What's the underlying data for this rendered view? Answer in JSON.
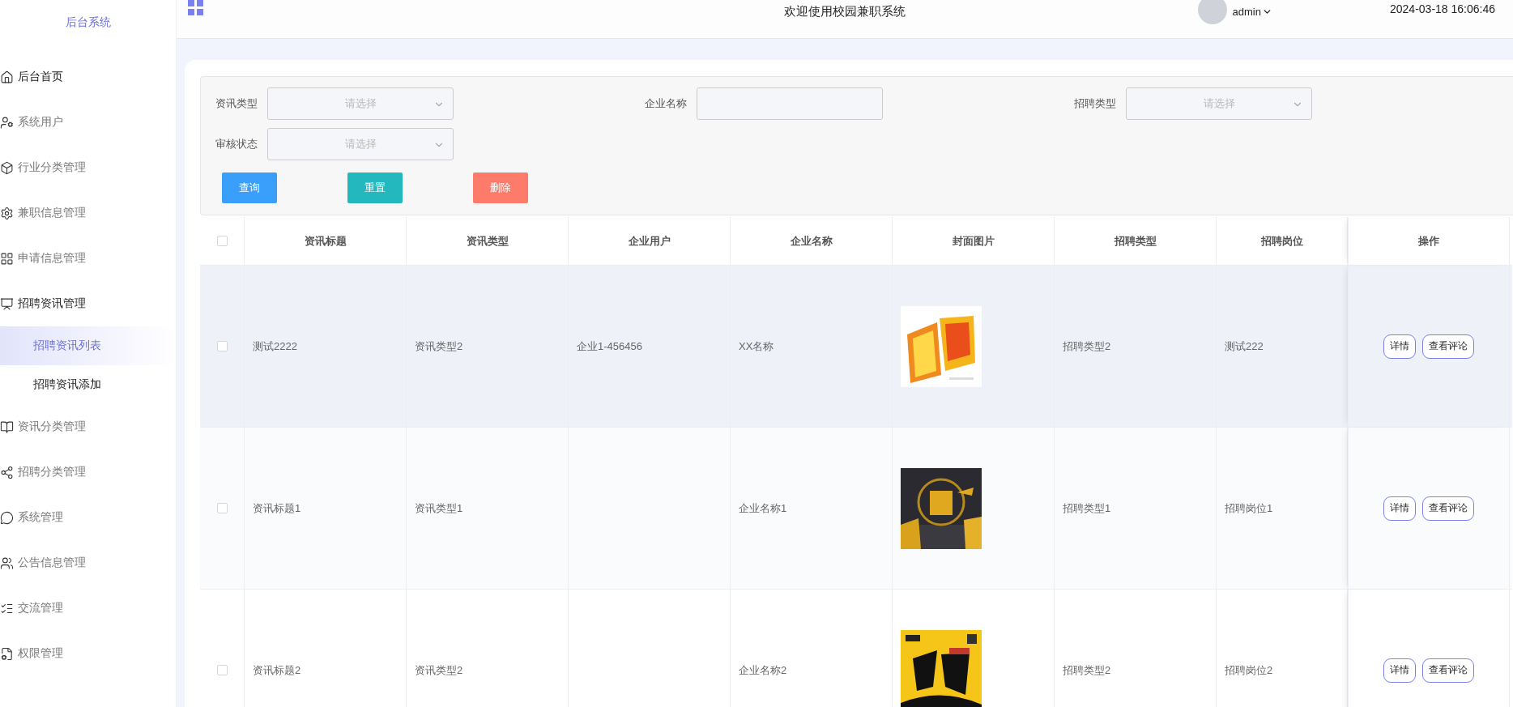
{
  "sidebar": {
    "title": "后台系统",
    "items": [
      {
        "label": "后台首页",
        "active": true
      },
      {
        "label": "系统用户",
        "active": false
      },
      {
        "label": "行业分类管理",
        "active": false
      },
      {
        "label": "兼职信息管理",
        "active": false
      },
      {
        "label": "申请信息管理",
        "active": false
      },
      {
        "label": "招聘资讯管理",
        "active": true,
        "children": [
          {
            "label": "招聘资讯列表",
            "selected": true
          },
          {
            "label": "招聘资讯添加",
            "selected": false
          }
        ]
      },
      {
        "label": "资讯分类管理",
        "active": false
      },
      {
        "label": "招聘分类管理",
        "active": false
      },
      {
        "label": "系统管理",
        "active": false
      },
      {
        "label": "公告信息管理",
        "active": false
      },
      {
        "label": "交流管理",
        "active": false
      },
      {
        "label": "权限管理",
        "active": false
      }
    ]
  },
  "header": {
    "title": "欢迎使用校园兼职系统",
    "user": "admin",
    "datetime": "2024-03-18 16:06:46"
  },
  "filters": [
    {
      "label": "资讯类型",
      "kind": "select",
      "placeholder": "请选择"
    },
    {
      "label": "企业名称",
      "kind": "input"
    },
    {
      "label": "招聘类型",
      "kind": "select",
      "placeholder": "请选择"
    },
    {
      "label": "审核状态",
      "kind": "select",
      "placeholder": "请选择"
    }
  ],
  "buttons": [
    {
      "label": "查询",
      "kind": "primary"
    },
    {
      "label": "重置",
      "kind": "reset"
    },
    {
      "label": "删除",
      "kind": "danger"
    }
  ],
  "table": {
    "all_checked": false,
    "columns": [
      "资讯标题",
      "资讯类型",
      "企业用户",
      "企业名称",
      "封面图片",
      "招聘类型",
      "招聘岗位",
      "操作"
    ],
    "rows": [
      {
        "highlighted": true,
        "checked": false,
        "cells": [
          "测试2222",
          "资讯类型2",
          "企业1-456456",
          "XX名称",
          {
            "kind": "picture"
          },
          "招聘类型2",
          "测试222"
        ],
        "actions": [
          "详情",
          "查看评论"
        ]
      },
      {
        "highlighted": false,
        "checked": false,
        "cells": [
          "资讯标题1",
          "资讯类型1",
          "",
          "企业名称1",
          {
            "kind": "picture"
          },
          "招聘类型1",
          "招聘岗位1"
        ],
        "actions": [
          "详情",
          "查看评论"
        ]
      },
      {
        "highlighted": false,
        "checked": false,
        "cells": [
          "资讯标题2",
          "资讯类型2",
          "",
          "企业名称2",
          {
            "kind": "picture"
          },
          "招聘类型2",
          "招聘岗位2"
        ],
        "actions": [
          "详情",
          "查看评论"
        ]
      }
    ]
  }
}
